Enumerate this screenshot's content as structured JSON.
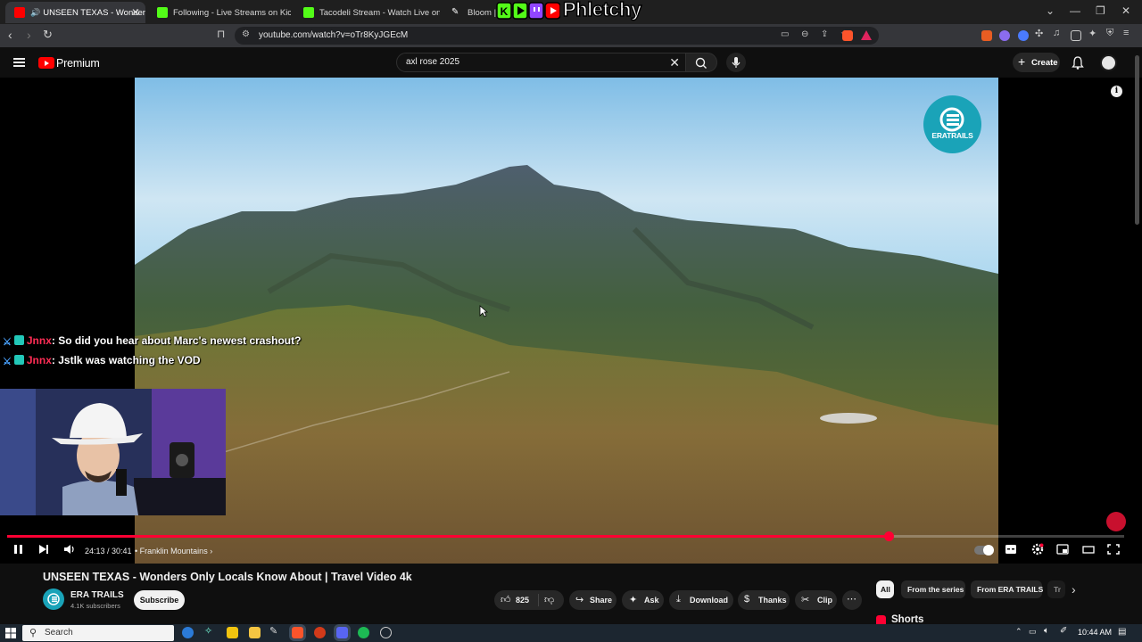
{
  "browser": {
    "tabs": [
      {
        "title": "UNSEEN TEXAS - Wonders Only",
        "favicon": "youtube-icon",
        "active": true
      },
      {
        "title": "Following - Live Streams on Kick",
        "favicon": "kick-icon",
        "active": false
      },
      {
        "title": "Tacodeli Stream - Watch Live on Kick",
        "favicon": "kick-icon",
        "active": false
      },
      {
        "title": "Bloom | Tra",
        "favicon": "bloom-icon",
        "active": false
      }
    ],
    "url": "youtube.com/watch?v=oTr8KyJGEcM",
    "extension_badge": "·"
  },
  "overlay_logo": {
    "text": "Phletchy"
  },
  "youtube": {
    "brand": "Premium",
    "search": {
      "value": "axl rose 2025"
    },
    "create_label": "Create"
  },
  "player": {
    "watermark": "ERATRAILS",
    "time": "24:13 / 30:41",
    "chapter": "Franklin Mountains",
    "progress": 0.789,
    "chapter_arrow": "›"
  },
  "chat": [
    {
      "user": "Jnnx",
      "message": ": So did you hear about Marc's newest crashout?"
    },
    {
      "user": "Jnnx",
      "message": ": Jstlk was watching the VOD"
    }
  ],
  "video": {
    "title": "UNSEEN TEXAS - Wonders Only Locals Know About | Travel Video 4k",
    "channel": "ERA TRAILS",
    "subscribers": "4.1K subscribers",
    "subscribe_label": "Subscribe",
    "likes": "825",
    "share_label": "Share",
    "ask_label": "Ask",
    "download_label": "Download",
    "thanks_label": "Thanks",
    "clip_label": "Clip"
  },
  "sidebar": {
    "chips": [
      "All",
      "From the series",
      "From ERA TRAILS",
      "Tr"
    ],
    "shorts_label": "Shorts"
  },
  "taskbar": {
    "search_placeholder": "Search",
    "time": "10:44 AM"
  },
  "colors": {
    "accent_red": "#ff0033",
    "kick_green": "#53fc18",
    "chat_user": "#ff2d55",
    "watermark_teal": "#1aa3b8"
  }
}
